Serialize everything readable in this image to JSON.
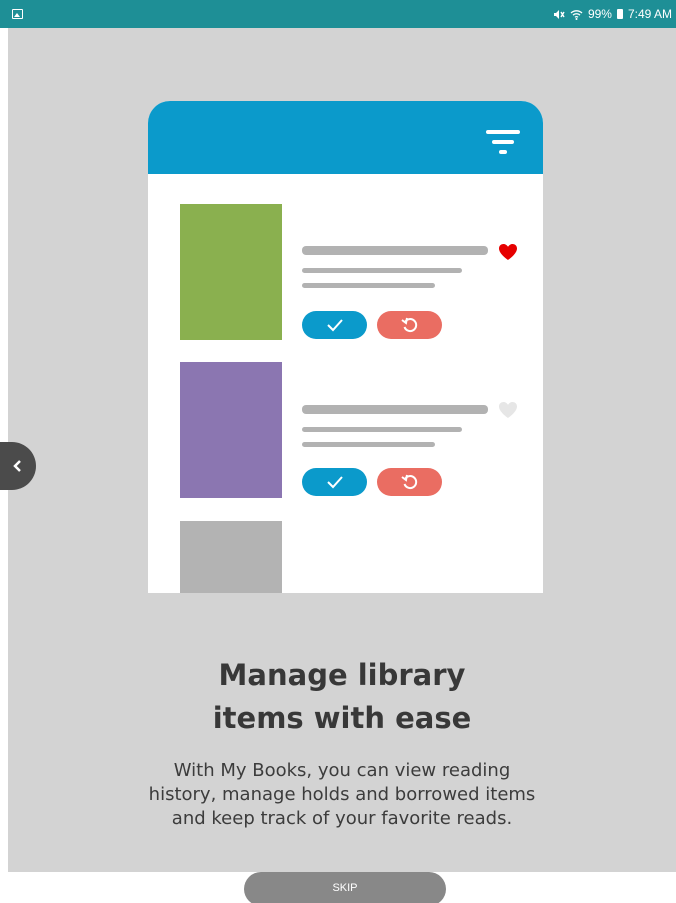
{
  "status_bar": {
    "battery": "99%",
    "time": "7:49 AM",
    "icons": [
      "gallery-icon",
      "mute-icon",
      "wifi-icon",
      "battery-icon"
    ]
  },
  "illustration": {
    "header_color": "#0b9acb",
    "books": [
      {
        "color": "#8ab04f",
        "favorited": true
      },
      {
        "color": "#8b76b1",
        "favorited": false
      },
      {
        "color": "#b3b3b3"
      }
    ],
    "heart_filled_color": "#e60000",
    "heart_empty_color": "#e6e6e6",
    "check_button_color": "#0b9acb",
    "renew_button_color": "#ea6d62"
  },
  "onboarding": {
    "title_line1": "Manage library",
    "title_line2": "items with ease",
    "description_line1": "With My Books, you can view reading",
    "description_line2": "history, manage holds and borrowed items",
    "description_line3": "and keep track of your favorite reads."
  },
  "skip_label": "SKIP"
}
